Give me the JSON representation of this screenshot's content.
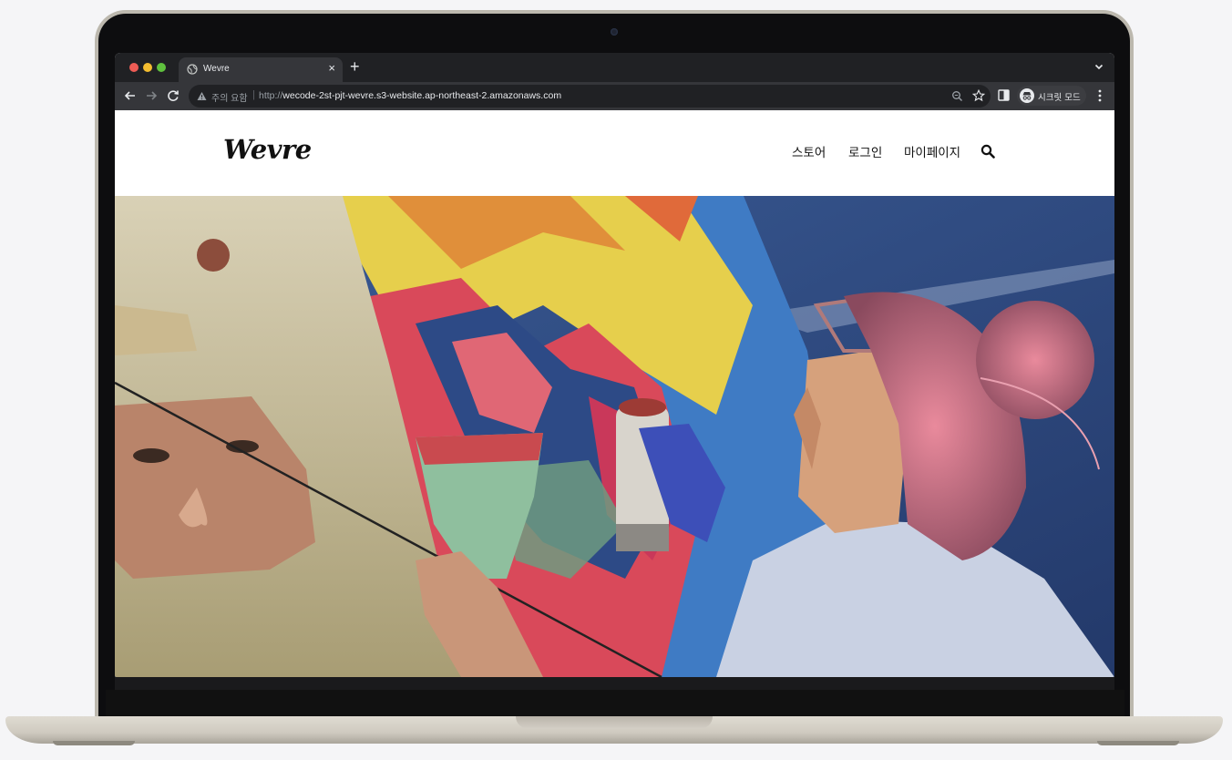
{
  "browser": {
    "tab_title": "Wevre",
    "new_tab_label": "+",
    "close_label": "×",
    "security_label": "주의 요함",
    "separator": "|",
    "url_scheme": "http://",
    "url_host": "wecode-2st-pjt-wevre.s3-website.ap-northeast-2.amazonaws.com",
    "profile_label": "시크릿 모드"
  },
  "site": {
    "logo": "Wevre",
    "nav": {
      "store": "스토어",
      "login": "로그인",
      "mypage": "마이페이지"
    }
  },
  "icons": {
    "favicon": "globe-icon",
    "warning": "warning-triangle-icon",
    "zoom": "zoom-icon",
    "bookmark": "star-icon",
    "side_panel": "side-panel-icon",
    "incognito": "incognito-icon",
    "menu": "kebab-menu-icon",
    "search": "search-icon"
  },
  "colors": {
    "browser_dark": "#202124",
    "toolbar": "#35363a",
    "text_primary": "#111111",
    "hero_sky": "#2e4a80"
  }
}
